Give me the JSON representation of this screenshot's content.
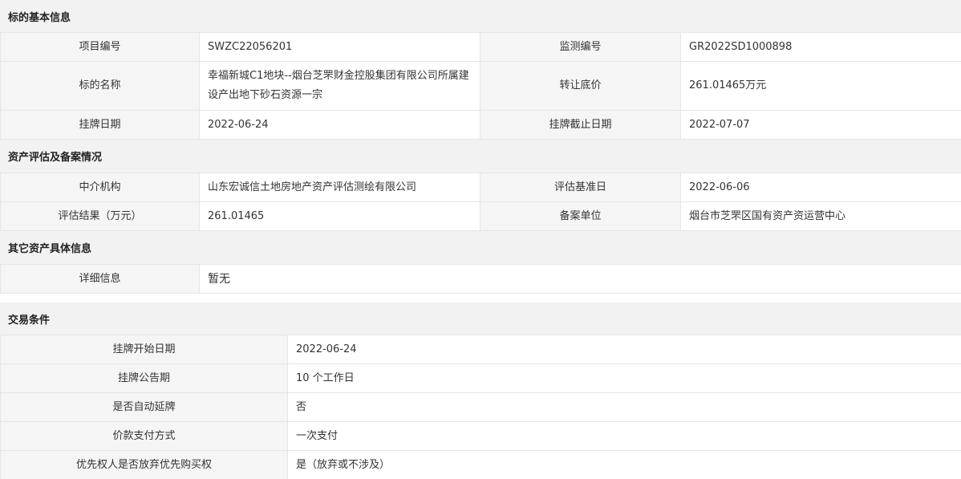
{
  "sections": {
    "basic": {
      "title": "标的基本信息",
      "project_no_label": "项目编号",
      "project_no": "SWZC22056201",
      "monitor_no_label": "监测编号",
      "monitor_no": "GR2022SD1000898",
      "name_label": "标的名称",
      "name": "幸福新城C1地块--烟台芝罘财金控股集团有限公司所属建设产出地下砂石资源一宗",
      "reserve_price_label": "转让底价",
      "reserve_price": "261.01465万元",
      "listing_date_label": "挂牌日期",
      "listing_date": "2022-06-24",
      "listing_end_label": "挂牌截止日期",
      "listing_end": "2022-07-07"
    },
    "evaluation": {
      "title": "资产评估及备案情况",
      "agency_label": "中介机构",
      "agency": "山东宏诚信土地房地产资产评估测绘有限公司",
      "base_date_label": "评估基准日",
      "base_date": "2022-06-06",
      "result_label": "评估结果（万元）",
      "result": "261.01465",
      "filing_unit_label": "备案单位",
      "filing_unit": "烟台市芝罘区国有资产资运营中心"
    },
    "other": {
      "title": "其它资产具体信息",
      "detail_label": "详细信息",
      "detail": "暂无"
    },
    "trade": {
      "title": "交易条件",
      "start_date_label": "挂牌开始日期",
      "start_date": "2022-06-24",
      "notice_period_label": "挂牌公告期",
      "notice_period": "10 个工作日",
      "auto_extend_label": "是否自动延牌",
      "auto_extend": "否",
      "payment_label": "价款支付方式",
      "payment": "一次支付",
      "preemption_label": "优先权人是否放弃优先购买权",
      "preemption": "是（放弃或不涉及）"
    }
  }
}
